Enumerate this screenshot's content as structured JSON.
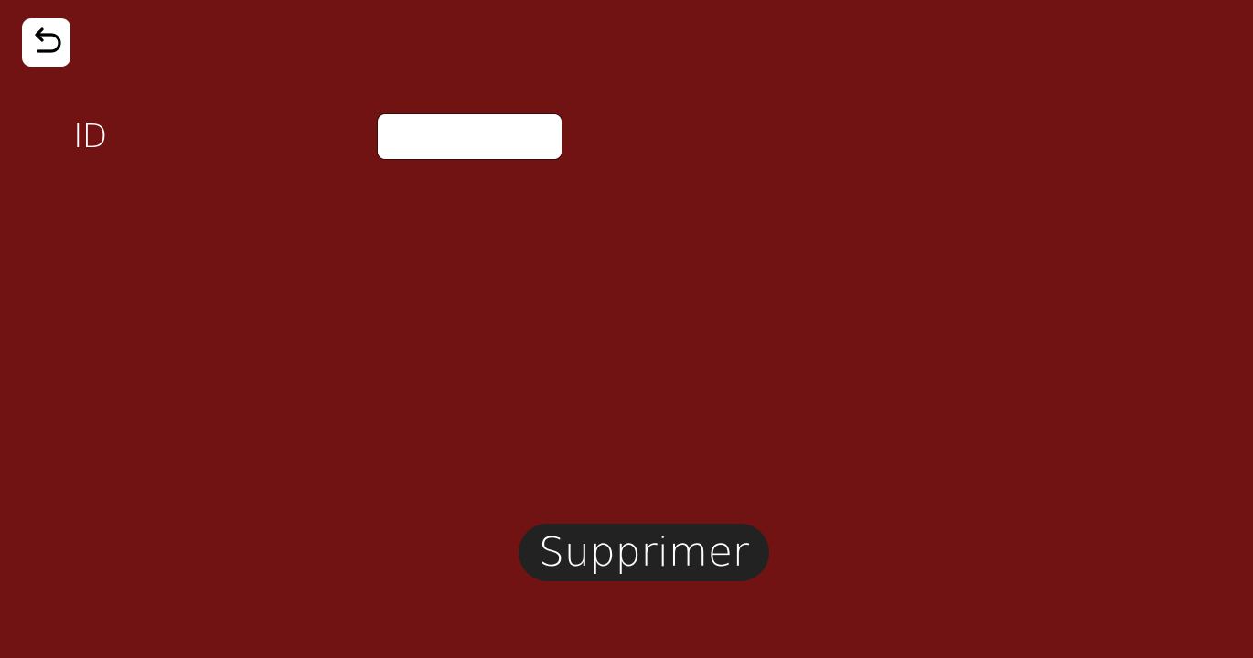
{
  "theme": {
    "background": "#721313",
    "button_background": "#222222",
    "input_background": "#ffffff",
    "text": "#ffffff"
  },
  "header": {
    "back_icon": "undo-arrow-icon"
  },
  "form": {
    "id_label": "ID",
    "id_value": "",
    "id_placeholder": ""
  },
  "actions": {
    "delete_label": "Supprimer"
  }
}
